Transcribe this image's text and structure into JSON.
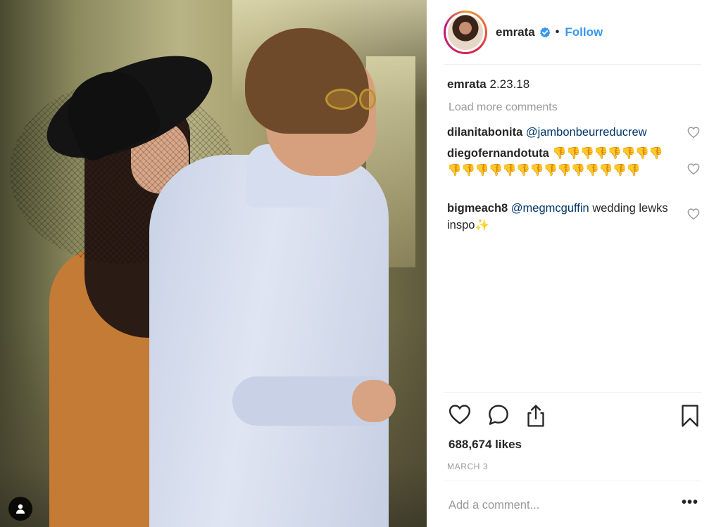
{
  "post": {
    "username": "emrata",
    "follow_label": "Follow",
    "separator": "•",
    "caption_user": "emrata",
    "caption_text": "2.23.18",
    "load_more": "Load more comments",
    "likes": "688,674 likes",
    "date": "March 3",
    "add_comment_placeholder": "Add a comment...",
    "more_label": "•••"
  },
  "comments": [
    {
      "user": "dilanitabonita",
      "mention": "@jambonbeurreducrew",
      "text": ""
    },
    {
      "user": "diegofernandotuta",
      "mention": "",
      "text": "👎👎👎👎👎👎👎👎👎👎👎👎👎👎👎👎👎👎👎👎👎👎"
    },
    {
      "user": "bigmeach8",
      "mention": "@megmcguffin",
      "text": "wedding lewks inspo",
      "emoji": "✨"
    }
  ],
  "icons": {
    "verified": "verified-badge-icon",
    "like": "heart-icon",
    "comment": "comment-bubble-icon",
    "share": "share-icon",
    "save": "bookmark-icon",
    "tagged": "person-tag-icon"
  },
  "colors": {
    "accent": "#3897f0",
    "text": "#262626",
    "muted": "#999999",
    "mention": "#003569",
    "divider": "#efefef"
  }
}
